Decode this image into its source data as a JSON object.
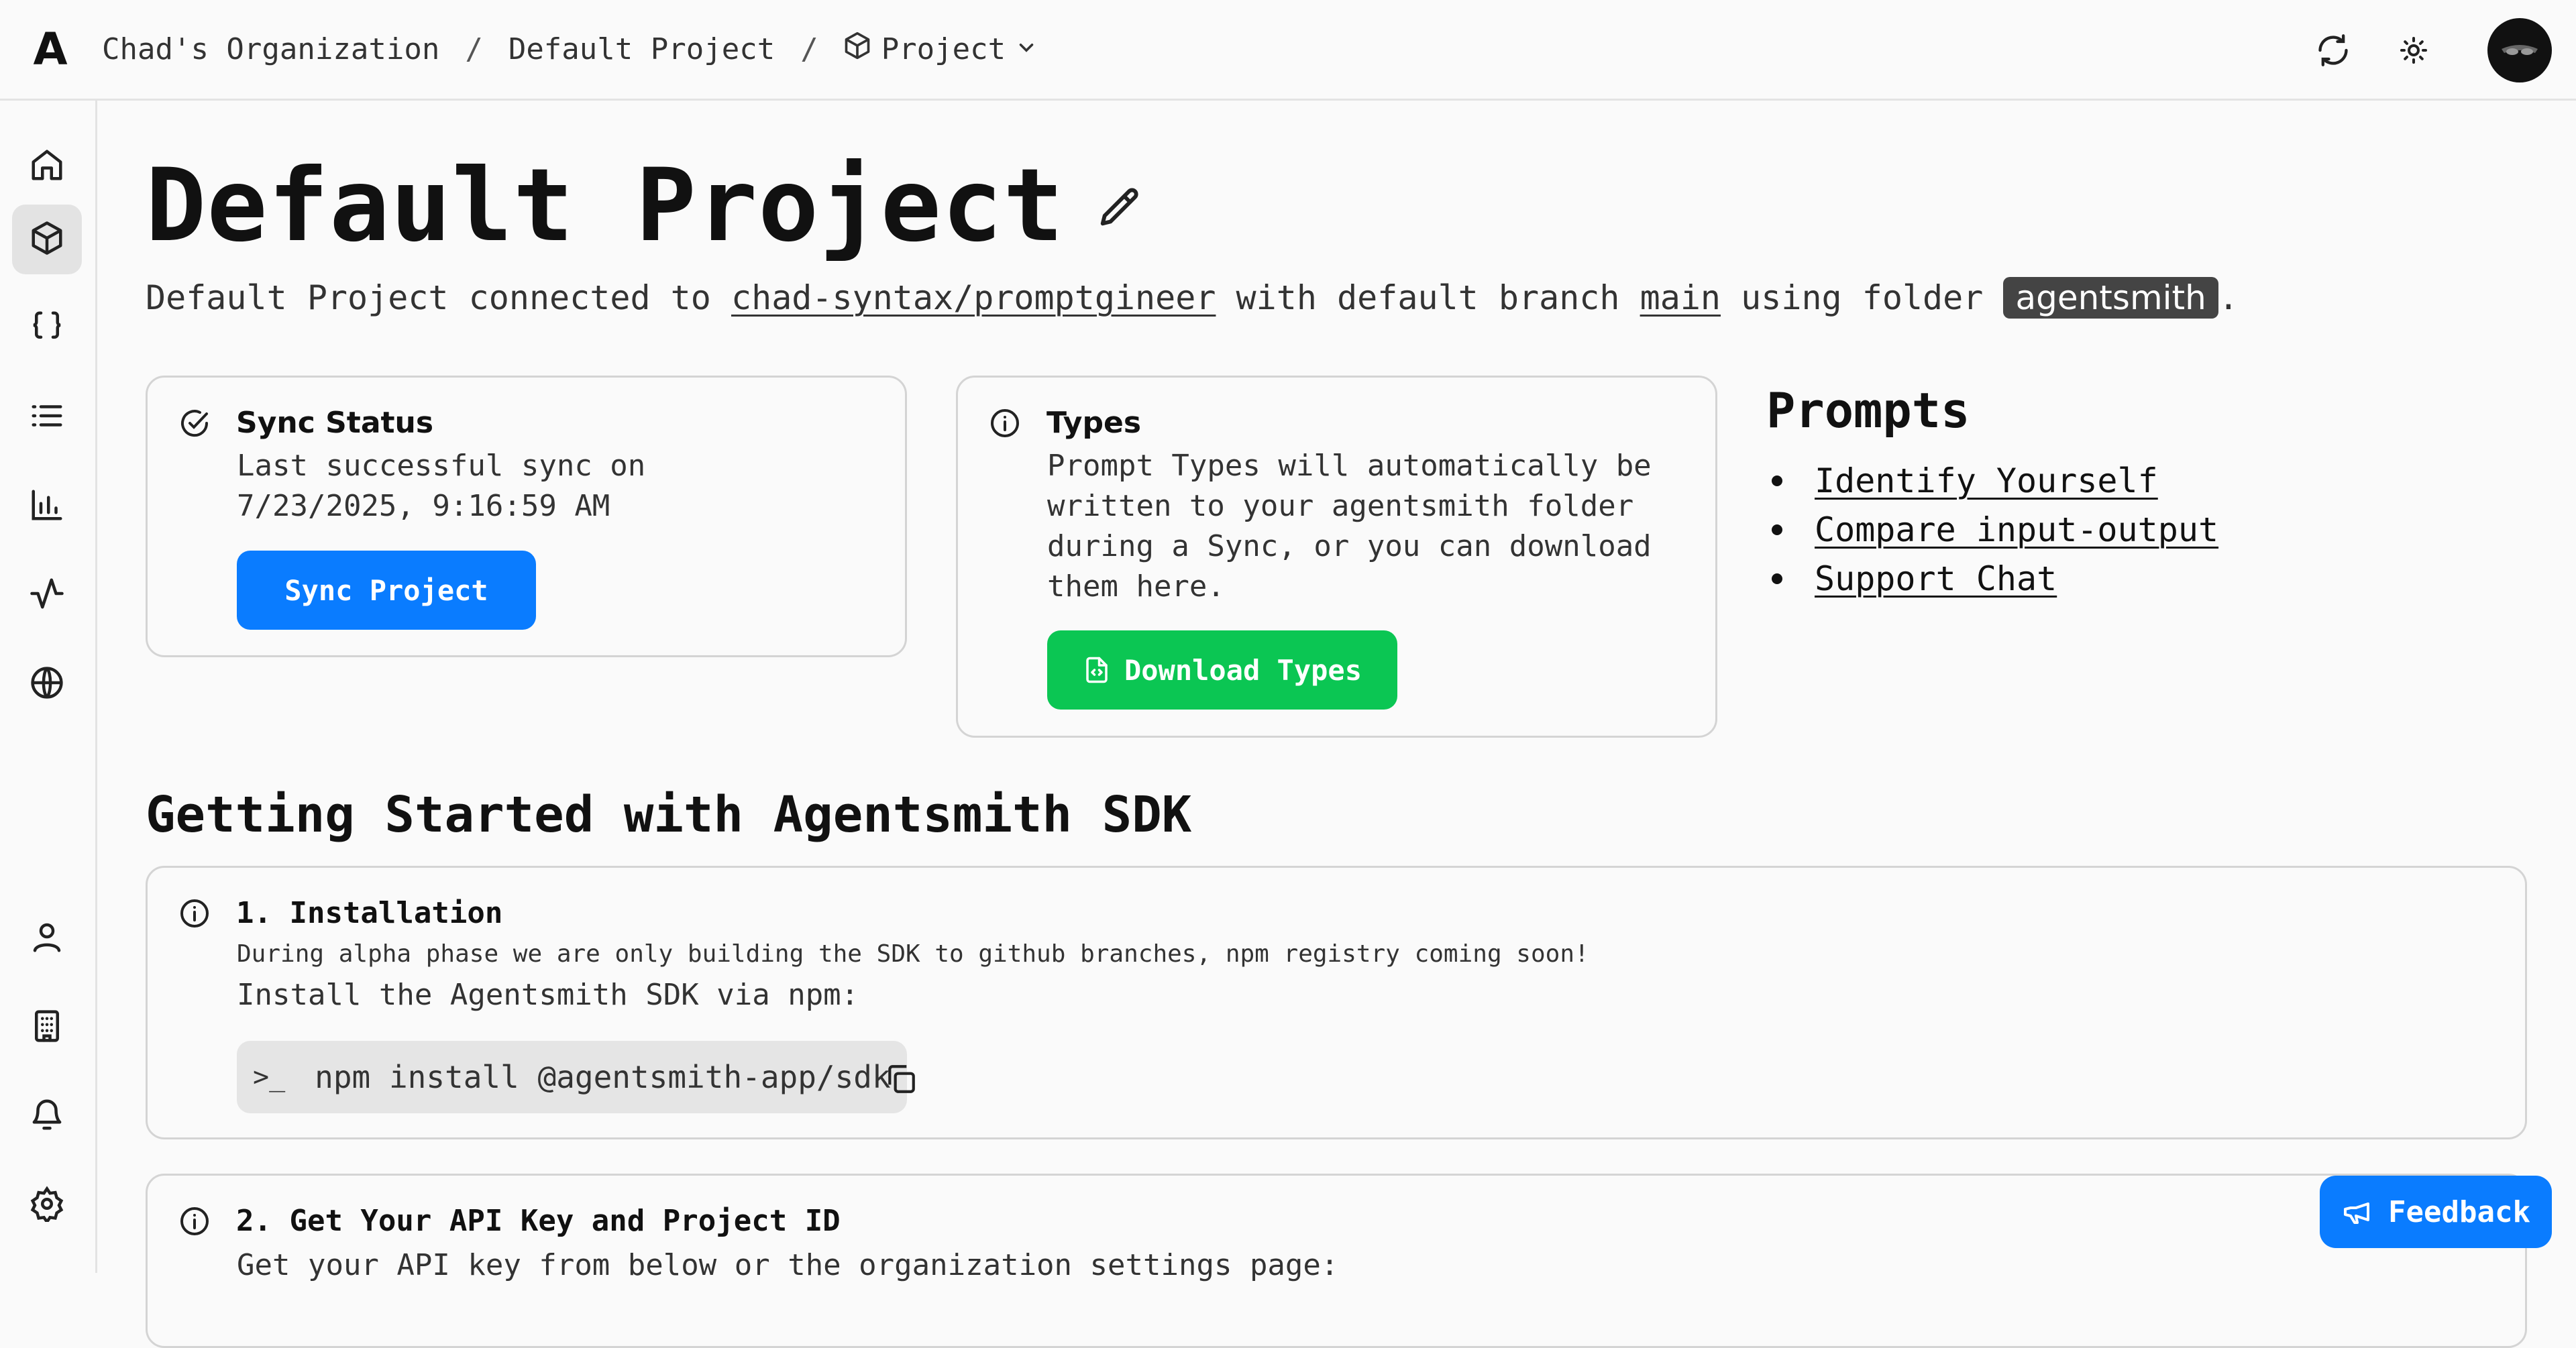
{
  "app": {
    "logo": "A"
  },
  "breadcrumb": {
    "org": "Chad's Organization",
    "project": "Default Project",
    "current": "Project",
    "separator": "/"
  },
  "page": {
    "title": "Default Project",
    "subtitle_prefix": "Default Project connected to ",
    "repo": "chad-syntax/promptgineer",
    "subtitle_mid": " with default branch ",
    "branch": "main",
    "subtitle_mid2": " using folder ",
    "folder": "agentsmith",
    "subtitle_end": "."
  },
  "sync_card": {
    "title": "Sync Status",
    "text_line1": "Last successful sync on",
    "text_line2": "7/23/2025, 9:16:59 AM",
    "button": "Sync Project"
  },
  "types_card": {
    "title": "Types",
    "lines": [
      "Prompt Types will automatically be",
      "written to your agentsmith folder",
      "during a Sync, or you can download",
      "them here."
    ],
    "button": "Download Types"
  },
  "prompts": {
    "title": "Prompts",
    "items": [
      "Identify Yourself",
      "Compare input-output",
      "Support Chat"
    ]
  },
  "getting_started": {
    "title": "Getting Started with Agentsmith SDK",
    "step1": {
      "title": "1. Installation",
      "note": "During alpha phase we are only building the SDK to github branches, npm registry coming soon!",
      "text": "Install the Agentsmith SDK via npm:",
      "prompt_symbol": ">_",
      "command": "npm install @agentsmith-app/sdk"
    },
    "step2": {
      "title": "2. Get Your API Key and Project ID",
      "text": "Get your API key from below or the organization settings page:"
    }
  },
  "feedback": {
    "label": "Feedback"
  },
  "colors": {
    "primary": "#0a7cff",
    "success": "#0bc653",
    "tag": "#444444"
  }
}
